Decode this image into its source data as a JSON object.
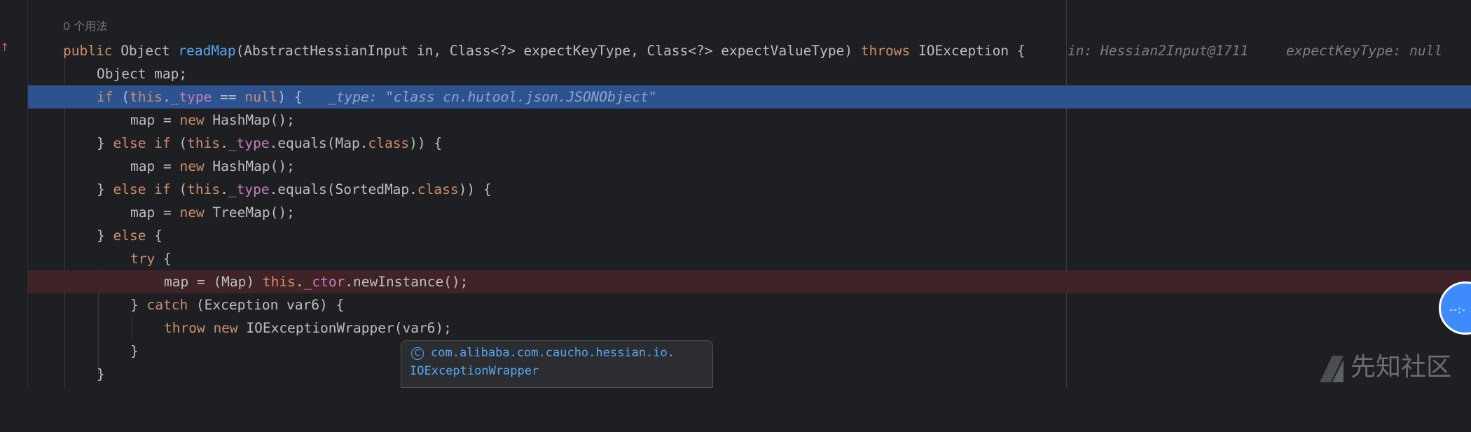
{
  "usages": "0 个用法",
  "lines": {
    "l1": {
      "kw1": "public ",
      "t1": "Object ",
      "fn": "readMap",
      "t2": "(AbstractHessianInput in, Class<?> expectKeyType, Class<?> expectValueType) ",
      "kw2": "throws ",
      "t3": "IOException {",
      "hint1": "in: Hessian2Input@1711",
      "hint2": "expectKeyType: null"
    },
    "l2": {
      "t1": "Object map;"
    },
    "l3": {
      "kw1": "if ",
      "t1": "(",
      "kw2": "this",
      "t2": ".",
      "fld": "_type",
      "t3": " == ",
      "kw3": "null",
      "t4": ") {",
      "hint": "_type: \"class cn.hutool.json.JSONObject\""
    },
    "l4": {
      "t1": "map = ",
      "kw1": "new ",
      "t2": "HashMap();"
    },
    "l5": {
      "t1": "} ",
      "kw1": "else if ",
      "t2": "(",
      "kw2": "this",
      "t3": ".",
      "fld": "_type",
      "t4": ".equals(Map.",
      "kw3": "class",
      "t5": ")) {"
    },
    "l6": {
      "t1": "map = ",
      "kw1": "new ",
      "t2": "HashMap();"
    },
    "l7": {
      "t1": "} ",
      "kw1": "else if ",
      "t2": "(",
      "kw2": "this",
      "t3": ".",
      "fld": "_type",
      "t4": ".equals(SortedMap.",
      "kw3": "class",
      "t5": ")) {"
    },
    "l8": {
      "t1": "map = ",
      "kw1": "new ",
      "t2": "TreeMap();"
    },
    "l9": {
      "t1": "} ",
      "kw1": "else ",
      "t2": "{"
    },
    "l10": {
      "kw1": "try ",
      "t1": "{"
    },
    "l11": {
      "t1": "map = (Map) ",
      "kw1": "this",
      "t2": ".",
      "fld": "_ctor",
      "t3": ".newInstance();"
    },
    "l12": {
      "t1": "} ",
      "kw1": "catch ",
      "t2": "(Exception var6) {"
    },
    "l13": {
      "kw1": "throw new ",
      "t1": "IOExceptionWrapper(var6);"
    },
    "l14": {
      "t1": "}"
    },
    "l15": {
      "t1": "}"
    }
  },
  "tooltip": {
    "icon": "class-icon",
    "line1": "com.alibaba.com.caucho.hessian.io.",
    "line2": "IOExceptionWrapper"
  },
  "watermark": "先知社区",
  "float_button": "--:-"
}
